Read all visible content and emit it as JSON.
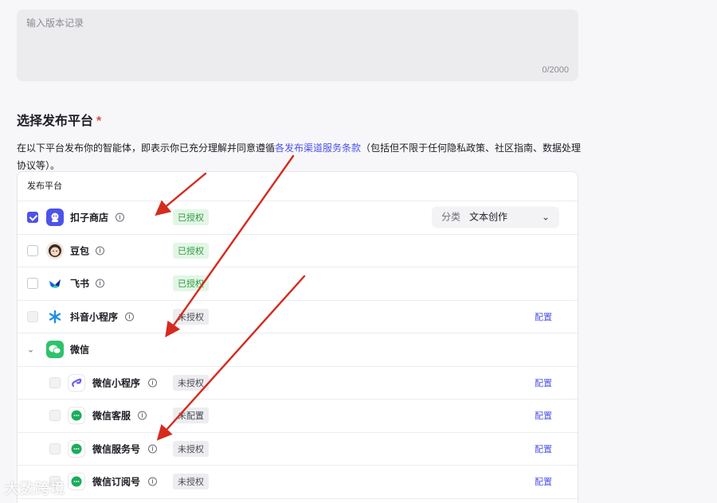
{
  "version_input": {
    "placeholder": "输入版本记录",
    "counter": "0/2000"
  },
  "section": {
    "title": "选择发布平台",
    "required_mark": "*",
    "desc_before": "在以下平台发布你的智能体，即表示你已充分理解并同意遵循",
    "desc_link": "各发布渠道服务条款",
    "desc_after": "（包括但不限于任何隐私政策、社区指南、数据处理协议等）。"
  },
  "table": {
    "header": "发布平台",
    "rows": {
      "coze_store": {
        "name": "扣子商店",
        "status": "已授权",
        "category_label": "分类",
        "category_value": "文本创作"
      },
      "doubao": {
        "name": "豆包",
        "status": "已授权"
      },
      "feishu": {
        "name": "飞书",
        "status": "已授权"
      },
      "douyin": {
        "name": "抖音小程序",
        "status": "未授权",
        "action": "配置"
      },
      "wechat_group": {
        "name": "微信"
      },
      "wechat_mini": {
        "name": "微信小程序",
        "status": "未授权",
        "action": "配置"
      },
      "wechat_kf": {
        "name": "微信客服",
        "status": "未配置",
        "action": "配置"
      },
      "wechat_service": {
        "name": "微信服务号",
        "status": "未授权",
        "action": "配置"
      },
      "wechat_sub": {
        "name": "微信订阅号",
        "status": "未授权",
        "action": "配置"
      }
    }
  },
  "watermark": "大数跨境",
  "colors": {
    "accent": "#4d53e8",
    "authorized": "#2e9a44",
    "arrow": "#d52b1e",
    "required": "#e5483f"
  }
}
